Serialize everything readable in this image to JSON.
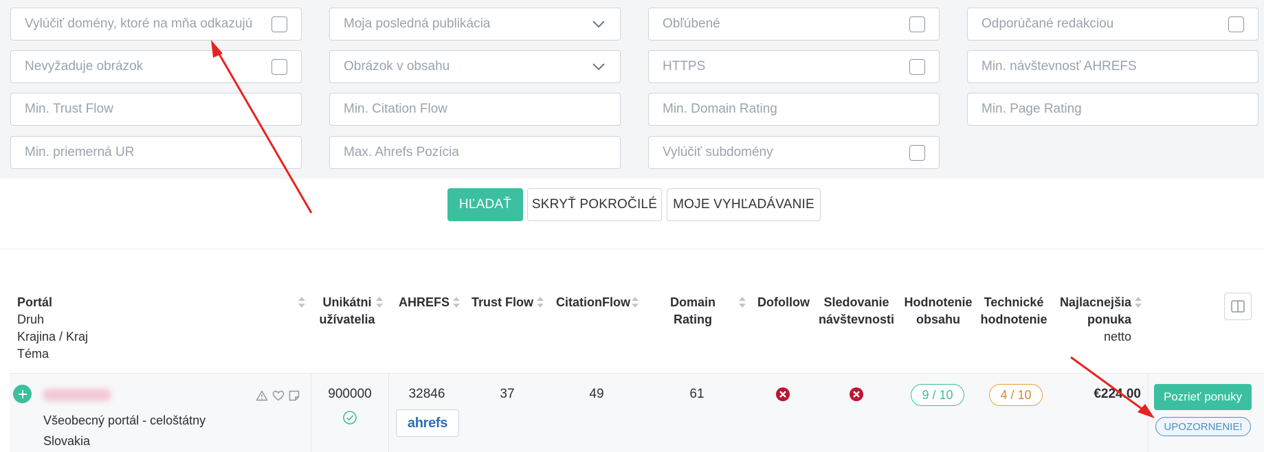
{
  "filters": {
    "exclude_linking_domains": "Vylúčiť domény, ktoré na mňa odkazujú",
    "my_last_publication": "Moja posledná publikácia",
    "favorites": "Obľúbené",
    "recommended_by_editors": "Odporúčané redakciou",
    "no_image_required": "Nevyžaduje obrázok",
    "image_in_content": "Obrázok v obsahu",
    "https": "HTTPS",
    "min_ahrefs_traffic": "Min. návštevnosť AHREFS",
    "min_trust_flow": "Min. Trust Flow",
    "min_citation_flow": "Min. Citation Flow",
    "min_domain_rating": "Min. Domain Rating",
    "min_page_rating": "Min. Page Rating",
    "min_avg_ur": "Min. priemerná UR",
    "max_ahrefs_position": "Max. Ahrefs Pozícia",
    "exclude_subdomains": "Vylúčiť subdomény"
  },
  "actions": {
    "search": "HĽADAŤ",
    "hide_advanced": "SKRYŤ POKROČILÉ",
    "my_search": "MOJE VYHĽADÁVANIE"
  },
  "table": {
    "headers": {
      "portal": "Portál",
      "portal_type": "Druh",
      "portal_country": "Krajina / Kraj",
      "portal_topic": "Téma",
      "unique_users": [
        "Unikátni",
        "užívatelia"
      ],
      "ahrefs": "AHREFS",
      "trust_flow": "Trust Flow",
      "citation_flow": "CitationFlow",
      "domain_rating": "Domain Rating",
      "dofollow": "Dofollow",
      "traffic_tracking": [
        "Sledovanie",
        "návštevnosti"
      ],
      "content_rating": [
        "Hodnotenie",
        "obsahu"
      ],
      "technical_rating": [
        "Technické",
        "hodnotenie"
      ],
      "cheapest_offer": [
        "Najlacnejšia",
        "ponuka"
      ],
      "cheapest_offer_sub": "netto"
    },
    "rows": [
      {
        "type": "Všeobecný portál - celoštátny",
        "country": "Slovakia",
        "unique_users": "900000",
        "ahrefs": "32846",
        "ahrefs_badge": "ahrefs",
        "trust_flow": "37",
        "citation_flow": "49",
        "domain_rating": "61",
        "content_rating": "9 / 10",
        "technical_rating": "4 / 10",
        "price": "€224.00",
        "view_offers": "Pozrieť ponuky",
        "warning": "UPOZORNENIE!"
      }
    ]
  },
  "colors": {
    "primary": "#3bbf9f",
    "danger": "#c0152f",
    "warning": "#e8a043",
    "info": "#4a90c2",
    "annotation": "#e8231f"
  }
}
